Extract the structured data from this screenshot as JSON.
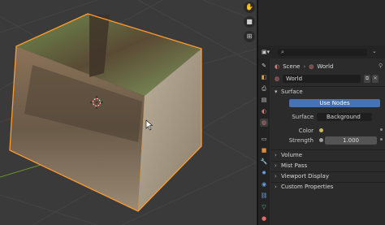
{
  "panel": {
    "breadcrumb": {
      "scene": "Scene",
      "world": "World"
    },
    "world_name": "World",
    "sections": {
      "surface": "Surface",
      "volume": "Volume",
      "mist_pass": "Mist Pass",
      "viewport_display": "Viewport Display",
      "custom_properties": "Custom Properties"
    },
    "use_nodes_label": "Use Nodes",
    "surface_label": "Surface",
    "surface_value": "Background",
    "color_label": "Color",
    "strength_label": "Strength",
    "strength_value": "1.000"
  },
  "colors": {
    "accent": "#4772b3",
    "selection_outline": "#ff9a2e",
    "panel_bg": "#2b2b2b",
    "viewport_bg": "#3a3a3a"
  },
  "icons": [
    "hand-gizmo-icon",
    "camera-gizmo-icon",
    "grid-gizmo-icon",
    "search-icon",
    "world-icon",
    "pin-icon",
    "browse-icon",
    "copy-icon",
    "close-icon",
    "chevron-down-icon",
    "chevron-right-icon",
    "tool-tab-icon",
    "render-tab-icon",
    "output-tab-icon",
    "view-layer-tab-icon",
    "scene-tab-icon",
    "world-tab-icon",
    "object-tab-icon",
    "modifier-tab-icon",
    "particles-tab-icon",
    "physics-tab-icon",
    "constraints-tab-icon",
    "data-tab-icon",
    "material-tab-icon",
    "texture-tab-icon"
  ]
}
